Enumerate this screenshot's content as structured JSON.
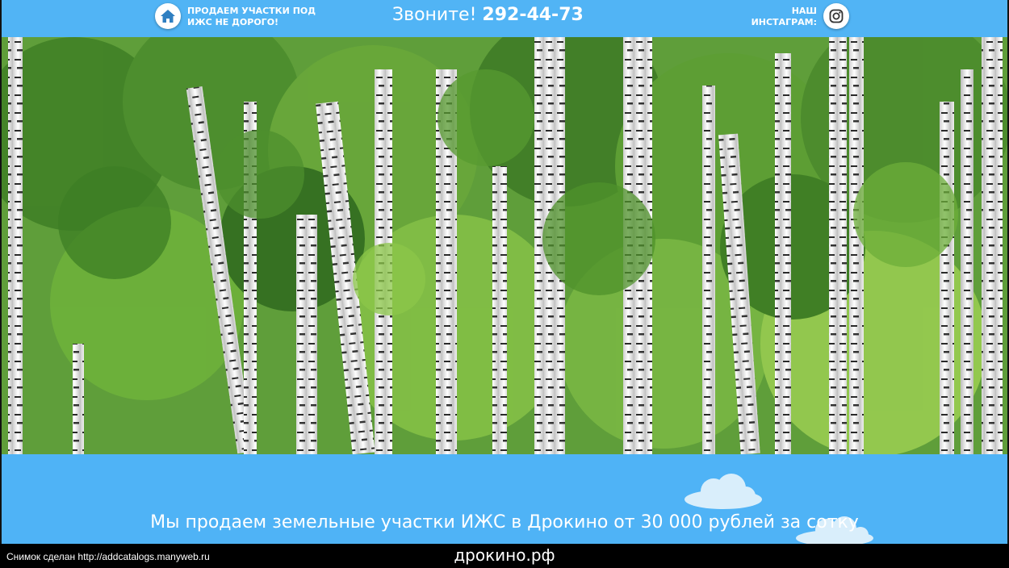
{
  "header": {
    "tagline": "ПРОДАЕМ УЧАСТКИ ПОД ИЖС НЕ ДОРОГО!",
    "call_label": "Звоните!",
    "phone": "292-44-73",
    "instagram_label": "НАШ ИНСТАГРАМ:",
    "home_icon": "home-icon",
    "instagram_icon": "instagram-icon"
  },
  "hero": {
    "image": "birch-forest-photo"
  },
  "main": {
    "subtitle": "Мы продаем земельные участки ИЖС в Дрокино от 30 000 рублей за сотку"
  },
  "footer": {
    "snapshot_note": "Снимок сделан http://addcatalogs.manyweb.ru",
    "domain": "дрокино.рф"
  },
  "colors": {
    "sky_blue": "#4fb3f6",
    "home_icon": "#2f7fc1",
    "instagram_icon": "#333333"
  }
}
